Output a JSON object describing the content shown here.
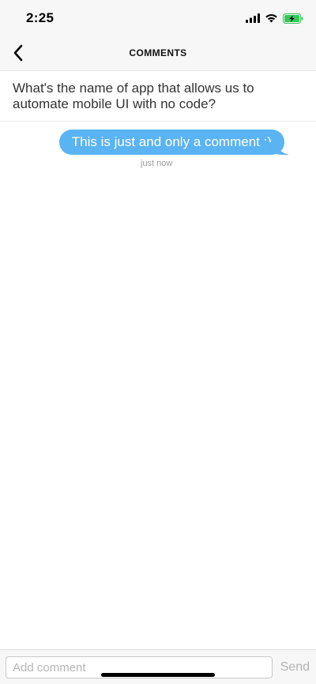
{
  "status_bar": {
    "time": "2:25",
    "icons": [
      "cellular-signal-icon",
      "wifi-icon",
      "battery-charging-icon"
    ],
    "battery_color": "#34c759"
  },
  "nav": {
    "back_icon": "chevron-left-icon",
    "title": "COMMENTS"
  },
  "post": {
    "question": "What's the name of app that allows us to automate mobile UI with no code?"
  },
  "comments": [
    {
      "text": "This is just and only a comment :)",
      "time": "just now",
      "bubble_color": "#5ab3f2"
    }
  ],
  "composer": {
    "placeholder": "Add comment",
    "value": "",
    "send_label": "Send"
  }
}
